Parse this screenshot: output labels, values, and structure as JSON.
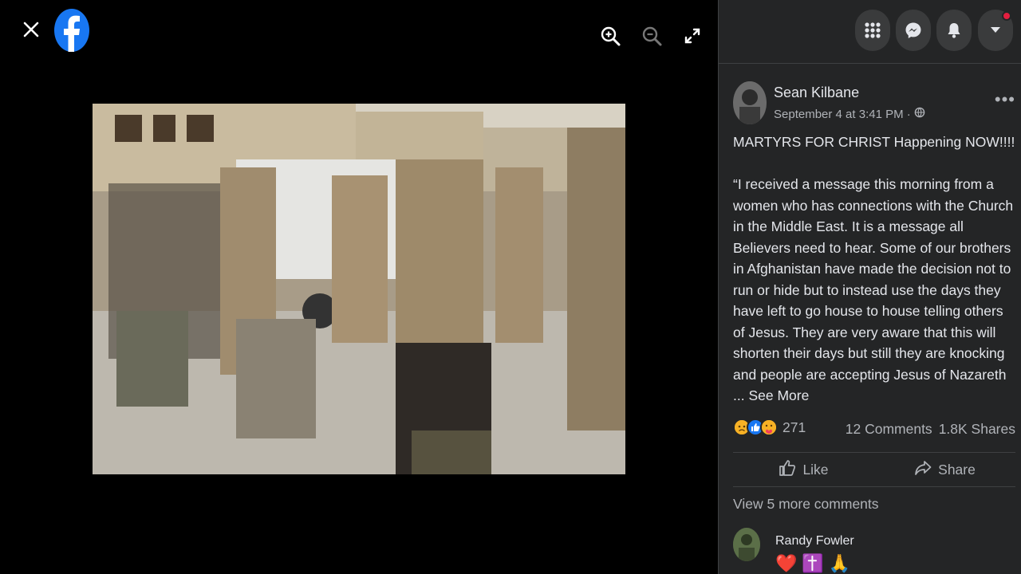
{
  "viewer": {
    "close_icon": "close-icon",
    "logo_icon": "facebook-logo-icon",
    "tools": [
      "zoom-in-icon",
      "zoom-out-icon",
      "fullscreen-icon"
    ]
  },
  "topbar": {
    "buttons": [
      "menu-grid-icon",
      "messenger-icon",
      "bell-icon",
      "account-caret-icon"
    ]
  },
  "post": {
    "author": "Sean Kilbane",
    "timestamp": "September 4 at 3:41 PM ·",
    "privacy_icon": "globe-icon",
    "headline": "MARTYRS FOR CHRIST Happening NOW!!!!",
    "body": "“I received a message this morning from a women who has connections with the Church in the Middle East. It is a message all Believers need to hear. Some of our brothers in Afghanistan have made the decision not to run or hide but to instead use the days they have left to go house to house telling others of Jesus. They are very aware that this will shorten their days but still they are knocking and people are accepting Jesus of Nazareth ...",
    "see_more": "See More"
  },
  "stats": {
    "reaction_count": "271",
    "comments": "12 Comments",
    "shares": "1.8K Shares"
  },
  "actions": {
    "like": "Like",
    "share": "Share"
  },
  "comments": {
    "view_more": "View 5 more comments",
    "items": [
      {
        "name": "Randy Fowler",
        "body": "❤️✝️🙏"
      }
    ]
  },
  "colors": {
    "panel": "#242526",
    "text": "#e4e6eb",
    "muted": "#b0b3b8",
    "fb_blue": "#1877f2",
    "notification": "#e41e3f"
  }
}
